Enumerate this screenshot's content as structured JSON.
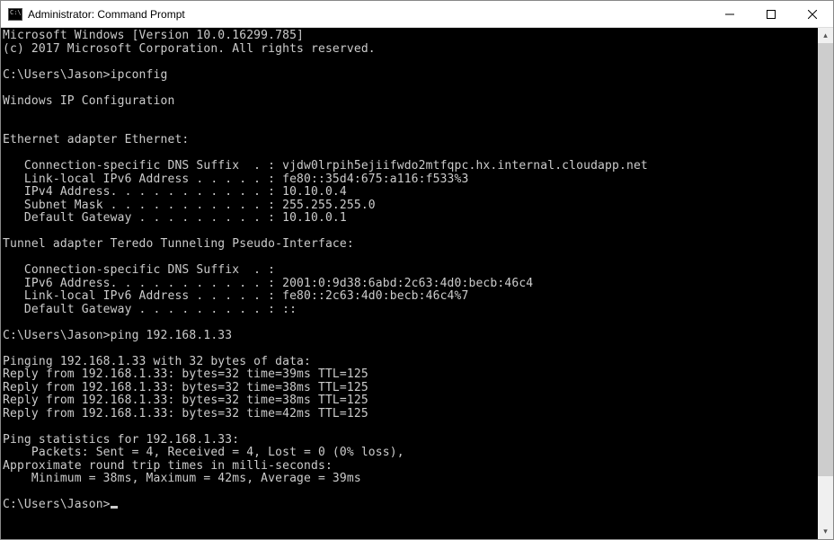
{
  "window": {
    "title": "Administrator: Command Prompt"
  },
  "terminal": {
    "lines": [
      "Microsoft Windows [Version 10.0.16299.785]",
      "(c) 2017 Microsoft Corporation. All rights reserved.",
      "",
      "C:\\Users\\Jason>ipconfig",
      "",
      "Windows IP Configuration",
      "",
      "",
      "Ethernet adapter Ethernet:",
      "",
      "   Connection-specific DNS Suffix  . : vjdw0lrpih5ejiifwdo2mtfqpc.hx.internal.cloudapp.net",
      "   Link-local IPv6 Address . . . . . : fe80::35d4:675:a116:f533%3",
      "   IPv4 Address. . . . . . . . . . . : 10.10.0.4",
      "   Subnet Mask . . . . . . . . . . . : 255.255.255.0",
      "   Default Gateway . . . . . . . . . : 10.10.0.1",
      "",
      "Tunnel adapter Teredo Tunneling Pseudo-Interface:",
      "",
      "   Connection-specific DNS Suffix  . :",
      "   IPv6 Address. . . . . . . . . . . : 2001:0:9d38:6abd:2c63:4d0:becb:46c4",
      "   Link-local IPv6 Address . . . . . : fe80::2c63:4d0:becb:46c4%7",
      "   Default Gateway . . . . . . . . . : ::",
      "",
      "C:\\Users\\Jason>ping 192.168.1.33",
      "",
      "Pinging 192.168.1.33 with 32 bytes of data:",
      "Reply from 192.168.1.33: bytes=32 time=39ms TTL=125",
      "Reply from 192.168.1.33: bytes=32 time=38ms TTL=125",
      "Reply from 192.168.1.33: bytes=32 time=38ms TTL=125",
      "Reply from 192.168.1.33: bytes=32 time=42ms TTL=125",
      "",
      "Ping statistics for 192.168.1.33:",
      "    Packets: Sent = 4, Received = 4, Lost = 0 (0% loss),",
      "Approximate round trip times in milli-seconds:",
      "    Minimum = 38ms, Maximum = 42ms, Average = 39ms",
      ""
    ],
    "current_prompt": "C:\\Users\\Jason>"
  }
}
